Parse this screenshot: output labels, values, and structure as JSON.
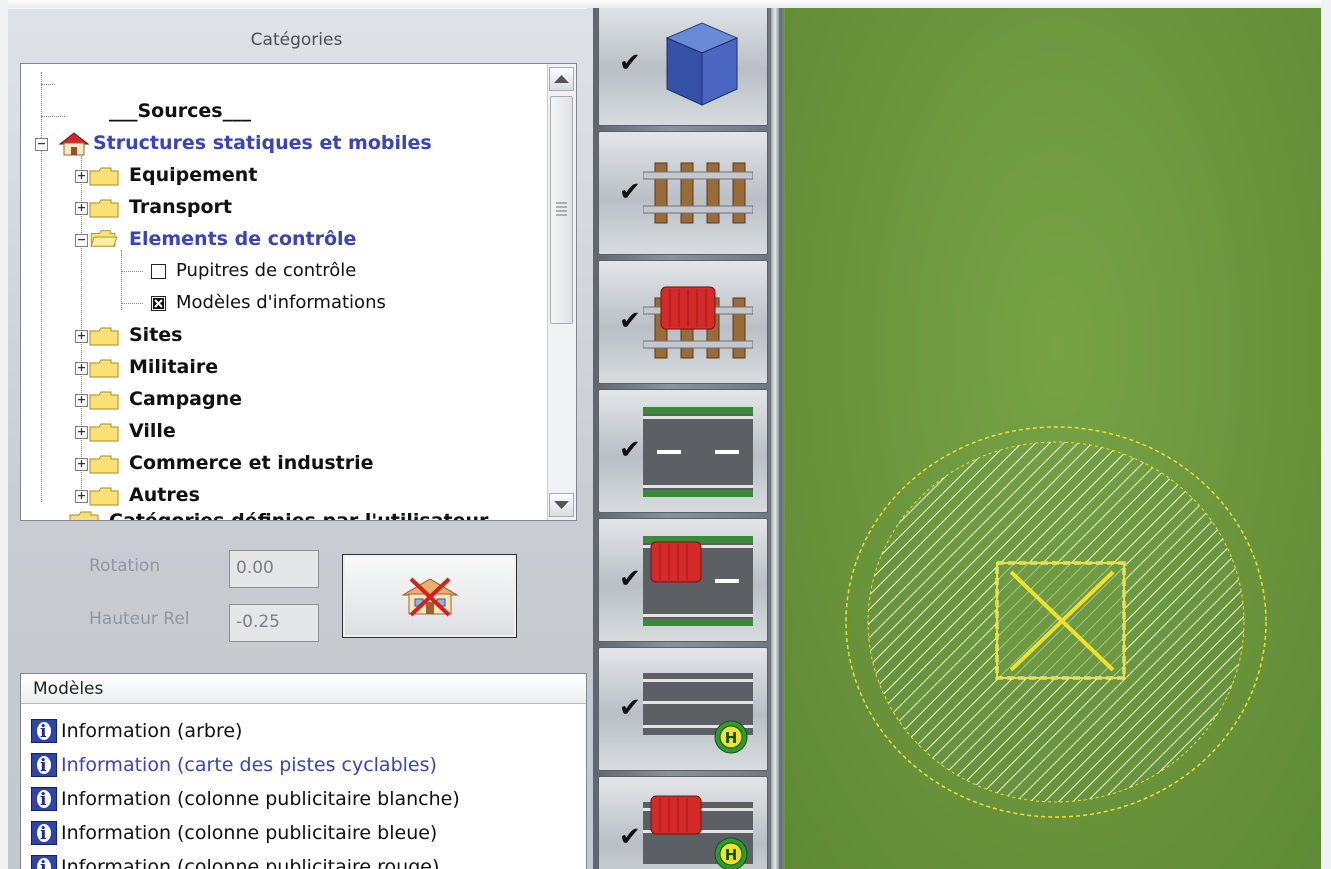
{
  "categories_panel": {
    "title": "Catégories",
    "tree": [
      {
        "label": "___Sources___",
        "style": "bold"
      },
      {
        "label": "Structures statiques et mobiles",
        "style": "blue"
      },
      {
        "label": "Equipement",
        "style": "bold"
      },
      {
        "label": "Transport",
        "style": "bold"
      },
      {
        "label": "Elements de contrôle",
        "style": "blue"
      },
      {
        "label": "Pupitres de contrôle",
        "style": "normal",
        "checked": false
      },
      {
        "label": "Modèles d'informations",
        "style": "normal",
        "checked": true
      },
      {
        "label": "Sites",
        "style": "bold"
      },
      {
        "label": "Militaire",
        "style": "bold"
      },
      {
        "label": "Campagne",
        "style": "bold"
      },
      {
        "label": "Ville",
        "style": "bold"
      },
      {
        "label": "Commerce et industrie",
        "style": "bold"
      },
      {
        "label": "Autres",
        "style": "bold"
      },
      {
        "label": "Catégories définies par l'utilisateur",
        "style": "bold"
      }
    ]
  },
  "transform": {
    "rotation_label": "Rotation",
    "rotation_value": "0.00",
    "height_label": "Hauteur Rel",
    "height_value": "-0.25"
  },
  "models_panel": {
    "header": "Modèles",
    "items": [
      {
        "label": "Information (arbre)",
        "selected": false
      },
      {
        "label": "Information (carte des pistes cyclables)",
        "selected": true
      },
      {
        "label": "Information (colonne publicitaire blanche)",
        "selected": false
      },
      {
        "label": "Information (colonne publicitaire bleue)",
        "selected": false
      },
      {
        "label": "Information (colonne publicitaire rouge)",
        "selected": false
      }
    ]
  },
  "toolbar": {
    "buttons": [
      {
        "icon": "cube-icon",
        "checked": true
      },
      {
        "icon": "rail-track-icon",
        "checked": true
      },
      {
        "icon": "rail-vehicle-icon",
        "checked": true
      },
      {
        "icon": "road-icon",
        "checked": true
      },
      {
        "icon": "road-vehicle-icon",
        "checked": true
      },
      {
        "icon": "bus-stop-icon",
        "checked": true
      },
      {
        "icon": "bus-stop-vehicle-icon",
        "checked": true
      }
    ]
  },
  "colors": {
    "tree_highlight": "#3a44b5",
    "map_green": "#6d9a40",
    "selection_yellow": "#f0e030"
  }
}
